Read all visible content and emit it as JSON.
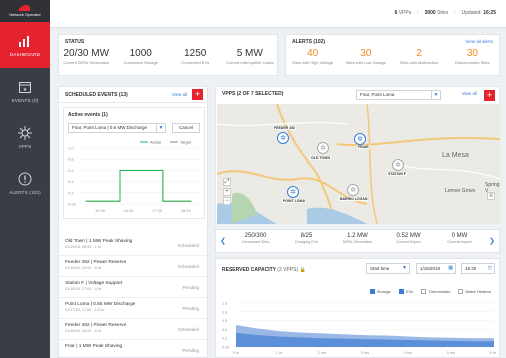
{
  "sidebar": {
    "logo_text": "Network Operator",
    "items": [
      {
        "label": "DASHBOARD",
        "icon": "bar-chart-icon",
        "active": true
      },
      {
        "label": "EVENTS (0)",
        "icon": "calendar-icon",
        "active": false
      },
      {
        "label": "VPPS",
        "icon": "network-icon",
        "active": false
      },
      {
        "label": "ALERTS (102)",
        "icon": "alert-icon",
        "active": false
      }
    ]
  },
  "topbar": {
    "vpps": "6",
    "vpps_label": "VPPs",
    "sites": "3000",
    "sites_label": "Sites",
    "updated_label": "Updated:",
    "updated_time": "16:25"
  },
  "status": {
    "title": "STATUS",
    "metrics": [
      {
        "value": "20/30 MW",
        "label": "Current DERs Generation"
      },
      {
        "value": "1000",
        "label": "Connected Storage"
      },
      {
        "value": "1250",
        "label": "Connected EVs"
      },
      {
        "value": "5 MW",
        "label": "Current Interruptible Loads"
      }
    ]
  },
  "alerts": {
    "title": "ALERTS (102)",
    "view_all": "View all alerts",
    "metrics": [
      {
        "value": "40",
        "label": "Sites with High Voltage"
      },
      {
        "value": "30",
        "label": "Sites with Low Voltage"
      },
      {
        "value": "2",
        "label": "Sites with Malfunction"
      },
      {
        "value": "30",
        "label": "Disconnected Sites"
      }
    ]
  },
  "scheduled": {
    "title": "SCHEDULED EVENTS (13)",
    "view_all": "View all",
    "active_title": "Active events (1)",
    "active_select": "Friar, Point Loma | 0.6 MW Discharge",
    "cancel": "Cancel",
    "legend_actual": "Actual",
    "legend_target": "Target",
    "y_ticks": [
      "1.0",
      "0.8",
      "0.6",
      "0.4",
      "0.2",
      "0.00"
    ],
    "x_ticks": [
      "15:30",
      "16:30",
      "17:30",
      "18:30"
    ],
    "events": [
      {
        "title": "Old Town  |  1 MW Peak Shaving",
        "sub": "01/15/18, 08:00 - 1 hr",
        "status": "Scheduled"
      },
      {
        "title": "Feeder 492  |  Power Reserve",
        "sub": "01/16/18, 10:00 - 6 hr",
        "status": "Scheduled"
      },
      {
        "title": "Station F  |  Voltage Support",
        "sub": "01/16/18, 17:00 - 4 hr",
        "status": "Pending"
      },
      {
        "title": "Point Loma  |  0.55 MW Discharge",
        "sub": "01/17/18, 17:00 - 1.5 hr",
        "status": "Pending"
      },
      {
        "title": "Feeder 492  |  Power Reserve",
        "sub": "01/18/18, 10:00 - 6 hr",
        "status": "Scheduled"
      },
      {
        "title": "Friar  |  1 MW Peak Shaving",
        "sub": "",
        "status": "Pending"
      }
    ]
  },
  "vpps": {
    "title": "VPPS (2 OF 7 SELECTED)",
    "select": "Friar, Point Loma",
    "view_all": "View all",
    "map_labels": [
      "La Mesa",
      "Lemon Grove",
      "Spring V"
    ],
    "pins": [
      {
        "label": "FEEDER 492"
      },
      {
        "label": "FRIAR"
      },
      {
        "label": "OLD TOWN"
      },
      {
        "label": "STATION F"
      },
      {
        "label": "POINT LOMA"
      },
      {
        "label": "BARRIO LOGAN"
      }
    ],
    "stats": [
      {
        "value": "250/300",
        "label": "Connected Sites"
      },
      {
        "value": "8/25",
        "label": "Charging EVs"
      },
      {
        "value": "1.2 MW",
        "label": "DERs Generation"
      },
      {
        "value": "0.52 MW",
        "label": "Current Export"
      },
      {
        "value": "0 MW",
        "label": "Current Import"
      }
    ]
  },
  "reserved": {
    "title": "RESERVED CAPACITY",
    "subtitle": "(2 VPPS)",
    "start_label": "Start time",
    "date": "1/15/2018",
    "time": "16:25",
    "checks": [
      {
        "label": "Storage",
        "on": true
      },
      {
        "label": "EVs",
        "on": true
      },
      {
        "label": "Thermostats",
        "on": false
      },
      {
        "label": "Water Heaters",
        "on": false
      }
    ],
    "y_ticks": [
      "1.0",
      "0.8",
      "0.6",
      "0.4",
      "0.2",
      "0.00"
    ],
    "x_ticks": [
      "0 hr",
      "1 hr",
      "2 hrs",
      "3 hrs",
      "4 hrs",
      "5 hrs",
      "6 hrs"
    ]
  },
  "chart_data": [
    {
      "type": "line",
      "xlabel": "",
      "ylabel": "",
      "x": [
        15.0,
        16.2,
        16.2,
        17.7,
        17.7,
        18.7
      ],
      "ylim": [
        0,
        1.0
      ],
      "series": [
        {
          "name": "Actual",
          "color": "#23b34b",
          "values": [
            0.05,
            0.05,
            0.6,
            0.6,
            0.05,
            0.05
          ]
        },
        {
          "name": "Target",
          "color": "#888888",
          "values": [
            0.05,
            0.05,
            0.6,
            0.6,
            0.05,
            0.05
          ]
        }
      ]
    },
    {
      "type": "area",
      "xlim": [
        0,
        6
      ],
      "ylim": [
        0,
        1.0
      ],
      "series": [
        {
          "name": "Storage",
          "color": "#9ab8e6",
          "x": [
            0,
            0.5,
            1,
            1.5,
            2,
            2.5,
            3,
            3.5,
            4,
            4.5,
            5,
            5.5,
            6
          ],
          "values": [
            0.5,
            0.42,
            0.36,
            0.33,
            0.31,
            0.29,
            0.27,
            0.26,
            0.24,
            0.22,
            0.21,
            0.2,
            0.2
          ]
        },
        {
          "name": "EVs",
          "color": "#5c8fd9",
          "x": [
            0,
            0.5,
            1,
            1.5,
            2,
            2.5,
            3,
            3.5,
            4,
            4.5,
            5,
            5.5,
            6
          ],
          "values": [
            0.32,
            0.27,
            0.24,
            0.22,
            0.2,
            0.19,
            0.18,
            0.17,
            0.16,
            0.15,
            0.14,
            0.13,
            0.13
          ]
        }
      ]
    }
  ]
}
